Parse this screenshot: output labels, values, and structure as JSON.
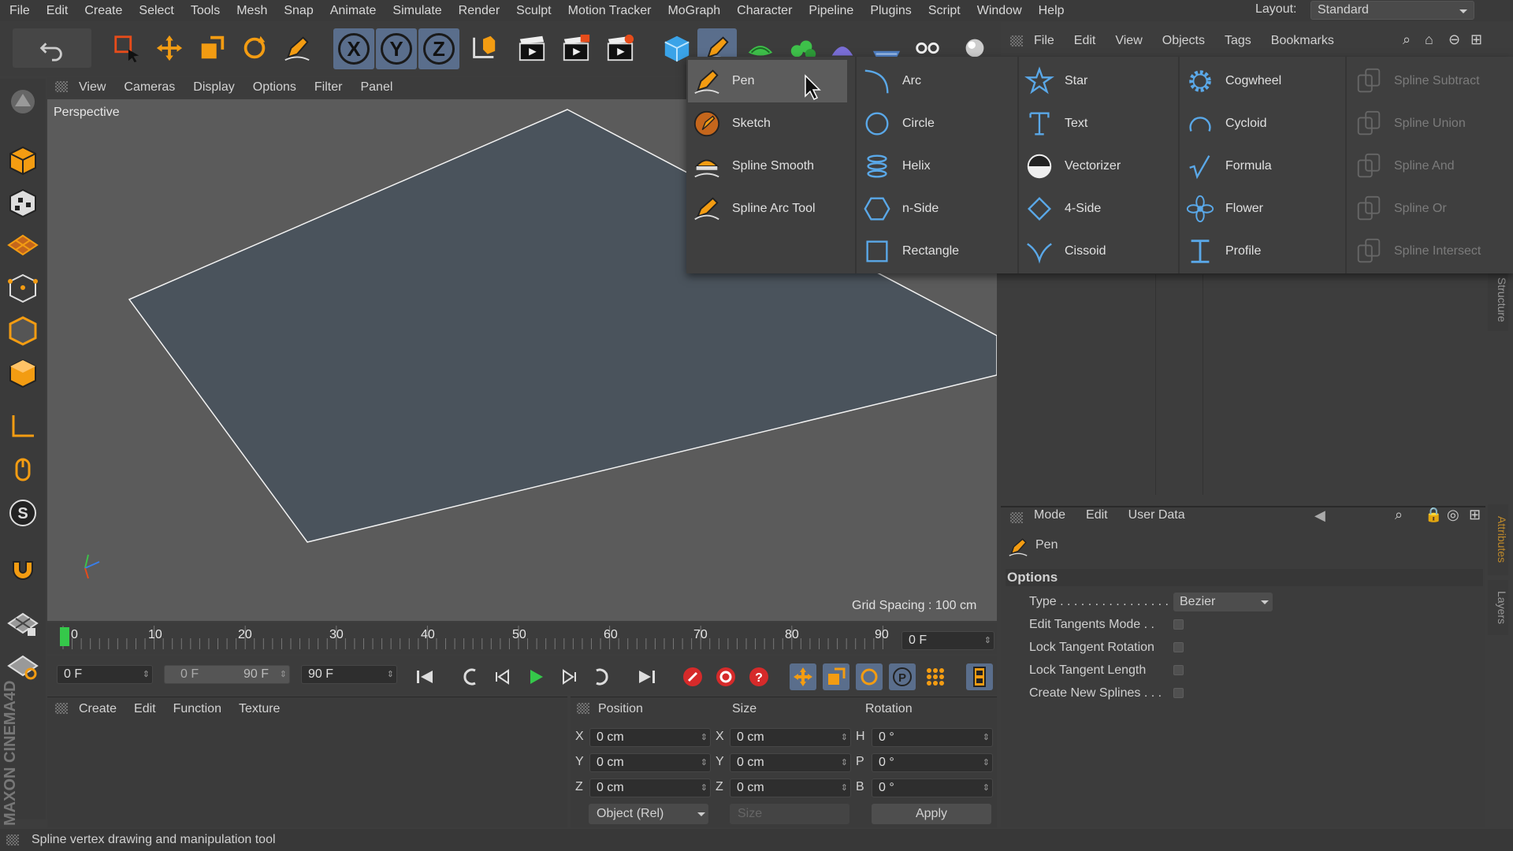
{
  "menubar": {
    "items": [
      "File",
      "Edit",
      "Create",
      "Select",
      "Tools",
      "Mesh",
      "Snap",
      "Animate",
      "Simulate",
      "Render",
      "Sculpt",
      "Motion Tracker",
      "MoGraph",
      "Character",
      "Pipeline",
      "Plugins",
      "Script",
      "Window",
      "Help"
    ],
    "layout_label": "Layout:",
    "layout_value": "Standard"
  },
  "toolbar": {
    "axis_x": "X",
    "axis_y": "Y",
    "axis_z": "Z"
  },
  "viewport": {
    "menu": [
      "View",
      "Cameras",
      "Display",
      "Options",
      "Filter",
      "Panel"
    ],
    "label": "Perspective",
    "grid_spacing": "Grid Spacing : 100 cm"
  },
  "timeline": {
    "ticks": [
      "0",
      "10",
      "20",
      "30",
      "40",
      "50",
      "60",
      "70",
      "80",
      "90"
    ],
    "current_frame": "0 F",
    "start_field": "0 F",
    "range_start": "0 F",
    "range_end": "90 F",
    "end_field": "90 F"
  },
  "material_manager": {
    "menu": [
      "Create",
      "Edit",
      "Function",
      "Texture"
    ]
  },
  "coordinates": {
    "headers": [
      "Position",
      "Size",
      "Rotation"
    ],
    "rows": [
      {
        "pos_axis": "X",
        "pos": "0 cm",
        "size_axis": "X",
        "size": "0 cm",
        "rot_axis": "H",
        "rot": "0 °"
      },
      {
        "pos_axis": "Y",
        "pos": "0 cm",
        "size_axis": "Y",
        "size": "0 cm",
        "rot_axis": "P",
        "rot": "0 °"
      },
      {
        "pos_axis": "Z",
        "pos": "0 cm",
        "size_axis": "Z",
        "size": "0 cm",
        "rot_axis": "B",
        "rot": "0 °"
      }
    ],
    "mode": "Object (Rel)",
    "size_mode": "Size",
    "apply": "Apply"
  },
  "object_manager": {
    "menu": [
      "File",
      "Edit",
      "View",
      "Objects",
      "Tags",
      "Bookmarks"
    ]
  },
  "attributes": {
    "menu": [
      "Mode",
      "Edit",
      "User Data"
    ],
    "tool_name": "Pen",
    "section": "Options",
    "type_label": "Type . . . . . . . . . . . . . . . .",
    "type_value": "Bezier",
    "options": [
      "Edit Tangents Mode . .",
      "Lock Tangent Rotation",
      "Lock Tangent Length",
      "Create New Splines . . ."
    ]
  },
  "side_tabs": [
    "Structure",
    "Attributes",
    "Layers"
  ],
  "spline_menu": {
    "col1": [
      "Pen",
      "Sketch",
      "Spline Smooth",
      "Spline Arc Tool"
    ],
    "col2": [
      "Arc",
      "Circle",
      "Helix",
      "n-Side",
      "Rectangle"
    ],
    "col3": [
      "Star",
      "Text",
      "Vectorizer",
      "4-Side",
      "Cissoid"
    ],
    "col4": [
      "Cogwheel",
      "Cycloid",
      "Formula",
      "Flower",
      "Profile"
    ],
    "col5": [
      "Spline Subtract",
      "Spline Union",
      "Spline And",
      "Spline Or",
      "Spline Intersect"
    ]
  },
  "branding": "MAXON CINEMA4D",
  "status": "Spline vertex drawing and manipulation tool",
  "colors": {
    "accent": "#f39c12",
    "axis_button": "#5a6e8c",
    "timeline_marker": "#35c84a",
    "plane": "#4a535c"
  }
}
